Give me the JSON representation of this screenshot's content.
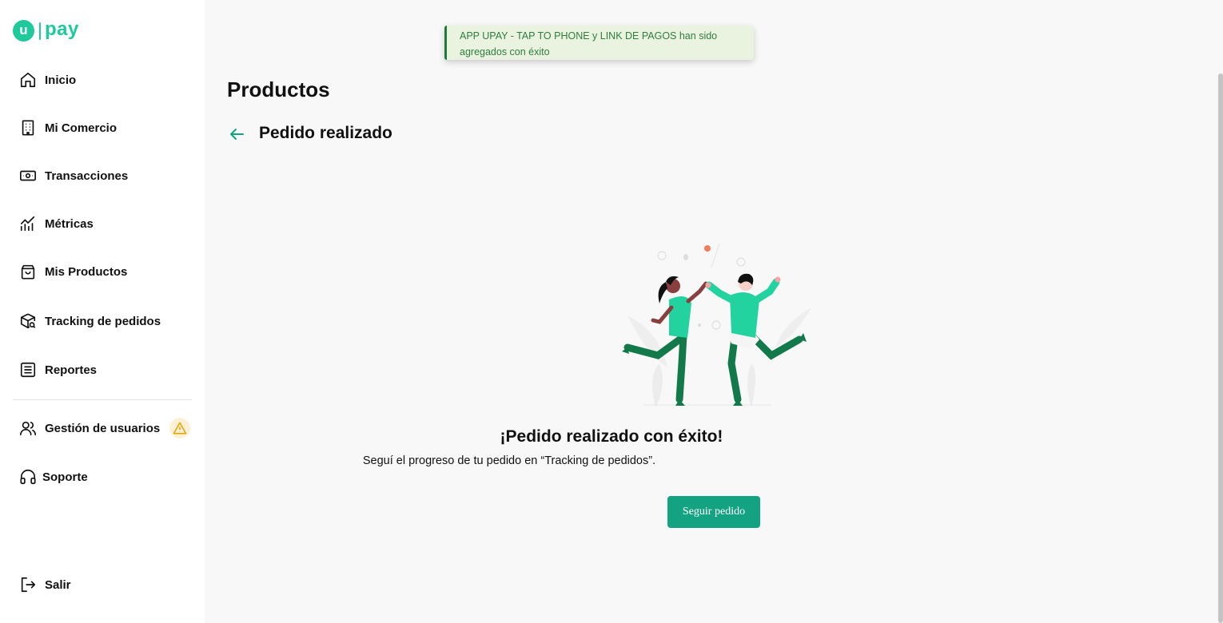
{
  "brand": {
    "logo_letter": "u",
    "logo_text": "pay",
    "color": "#1ec99b"
  },
  "sidebar": {
    "items": [
      {
        "label": "Inicio",
        "icon": "home-icon"
      },
      {
        "label": "Mi Comercio",
        "icon": "building-icon"
      },
      {
        "label": "Transacciones",
        "icon": "banknote-icon"
      },
      {
        "label": "Métricas",
        "icon": "chart-icon"
      },
      {
        "label": "Mis Productos",
        "icon": "bag-icon"
      },
      {
        "label": "Tracking de pedidos",
        "icon": "package-search-icon"
      },
      {
        "label": "Reportes",
        "icon": "report-icon"
      },
      {
        "label": "Gestión de usuarios",
        "icon": "users-icon",
        "badge": "warning-icon"
      },
      {
        "label": "Soporte",
        "icon": "headset-icon"
      },
      {
        "label": "Salir",
        "icon": "logout-icon"
      }
    ]
  },
  "toast": {
    "line1": "APP UPAY - TAP TO PHONE y LINK DE PAGOS han sido",
    "line2": "agregados con éxito",
    "accent": "#1f7a3a"
  },
  "main": {
    "page_title": "Productos",
    "sub_title": "Pedido realizado",
    "success_title": "¡Pedido realizado con éxito!",
    "success_message": "Seguí el progreso de tu pedido en “Tracking de pedidos”.",
    "cta_label": "Seguir pedido",
    "cta_color": "#14a382"
  }
}
